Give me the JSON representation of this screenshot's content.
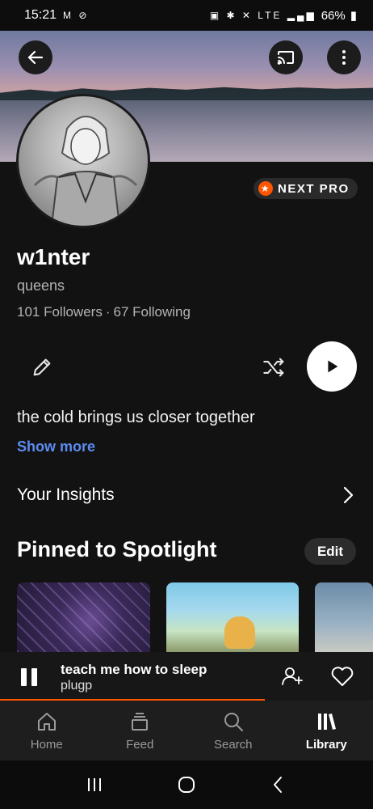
{
  "status_bar": {
    "time": "15:21",
    "battery": "66%",
    "left_icons": "M ⊘",
    "right_icons": "▣ ✱ ✕ LTE ▂▄▆"
  },
  "header": {
    "back_icon": "arrow-left-icon",
    "cast_icon": "cast-icon",
    "more_icon": "more-vertical-icon"
  },
  "profile": {
    "badge": "NEXT PRO",
    "username": "w1nter",
    "location": "queens",
    "followers": "101 Followers",
    "separator": "·",
    "following": "67 Following",
    "bio": "the cold brings us closer together",
    "show_more": "Show more"
  },
  "insights": {
    "label": "Your Insights"
  },
  "spotlight": {
    "title": "Pinned to Spotlight",
    "edit_label": "Edit"
  },
  "mini_player": {
    "track_title": "teach me how to sleep",
    "artist": "plugp",
    "progress": 0.71
  },
  "tabs": [
    {
      "label": "Home",
      "icon": "home-icon"
    },
    {
      "label": "Feed",
      "icon": "feed-icon"
    },
    {
      "label": "Search",
      "icon": "search-icon"
    },
    {
      "label": "Library",
      "icon": "library-icon"
    }
  ],
  "colors": {
    "accent": "#ff5500",
    "link": "#5b8cf0",
    "background": "#121212"
  }
}
